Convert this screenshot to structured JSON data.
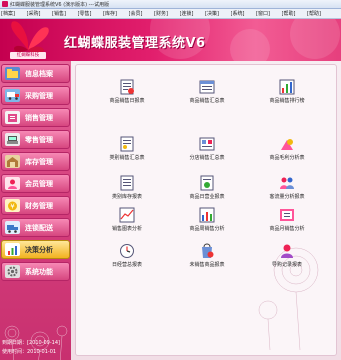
{
  "window": {
    "title": "红蝴蝶服装管理系统V6 (演示版本)  ---试用版"
  },
  "menu": [
    "[档案]",
    "[采购]",
    "[销售]",
    "[零售]",
    "[库存]",
    "[会员]",
    "[财务]",
    "[连锁]",
    "[决策]",
    "[系统]",
    "[窗口]",
    "[帮助]",
    "[帮助]"
  ],
  "banner": {
    "app_title": "红蝴蝶服装管理系统V6",
    "logo_text": "红蝴蝶科技"
  },
  "sidebar": {
    "items": [
      {
        "label": "信息档案",
        "icon": "folder-icon"
      },
      {
        "label": "采购管理",
        "icon": "truck-icon"
      },
      {
        "label": "销售管理",
        "icon": "sales-icon"
      },
      {
        "label": "零售管理",
        "icon": "pos-icon"
      },
      {
        "label": "库存管理",
        "icon": "warehouse-icon"
      },
      {
        "label": "会员管理",
        "icon": "member-icon"
      },
      {
        "label": "财务管理",
        "icon": "finance-icon"
      },
      {
        "label": "连锁配送",
        "icon": "delivery-icon"
      },
      {
        "label": "决策分析",
        "icon": "chart-icon"
      },
      {
        "label": "系统功能",
        "icon": "gear-icon"
      }
    ],
    "active_index": 8
  },
  "status": {
    "line1": "到期日期：[2010-09-14]",
    "line2": "使用时间：2010-01-01"
  },
  "reports": [
    {
      "label": "商品销售日报表",
      "icon": "daily-report-icon"
    },
    {
      "label": "商品销售汇总表",
      "icon": "summary-report-icon"
    },
    {
      "label": "商品销售排行榜",
      "icon": "ranking-icon"
    },
    {
      "label": "类别销售汇总表",
      "icon": "category-report-icon"
    },
    {
      "label": "分店销售汇总表",
      "icon": "branch-report-icon"
    },
    {
      "label": "商品毛利分析表",
      "icon": "profit-icon"
    },
    {
      "label": "类别库存报表",
      "icon": "stock-report-icon"
    },
    {
      "label": "商品日营业报表",
      "icon": "business-report-icon"
    },
    {
      "label": "客流量分析报表",
      "icon": "traffic-icon"
    },
    {
      "label": "销售图表分析",
      "icon": "sales-chart-icon"
    },
    {
      "label": "商品周销售分析",
      "icon": "weekly-report-icon"
    },
    {
      "label": "商品月销售分析",
      "icon": "monthly-report-icon"
    },
    {
      "label": "日经营总报表",
      "icon": "day-total-icon"
    },
    {
      "label": "未销售商品报表",
      "icon": "unsold-icon"
    },
    {
      "label": "导购记录报表",
      "icon": "guide-record-icon"
    }
  ],
  "colors": {
    "brand": "#d40f5c",
    "sidebar": "#d53f7d",
    "active": "#f2b21f"
  }
}
